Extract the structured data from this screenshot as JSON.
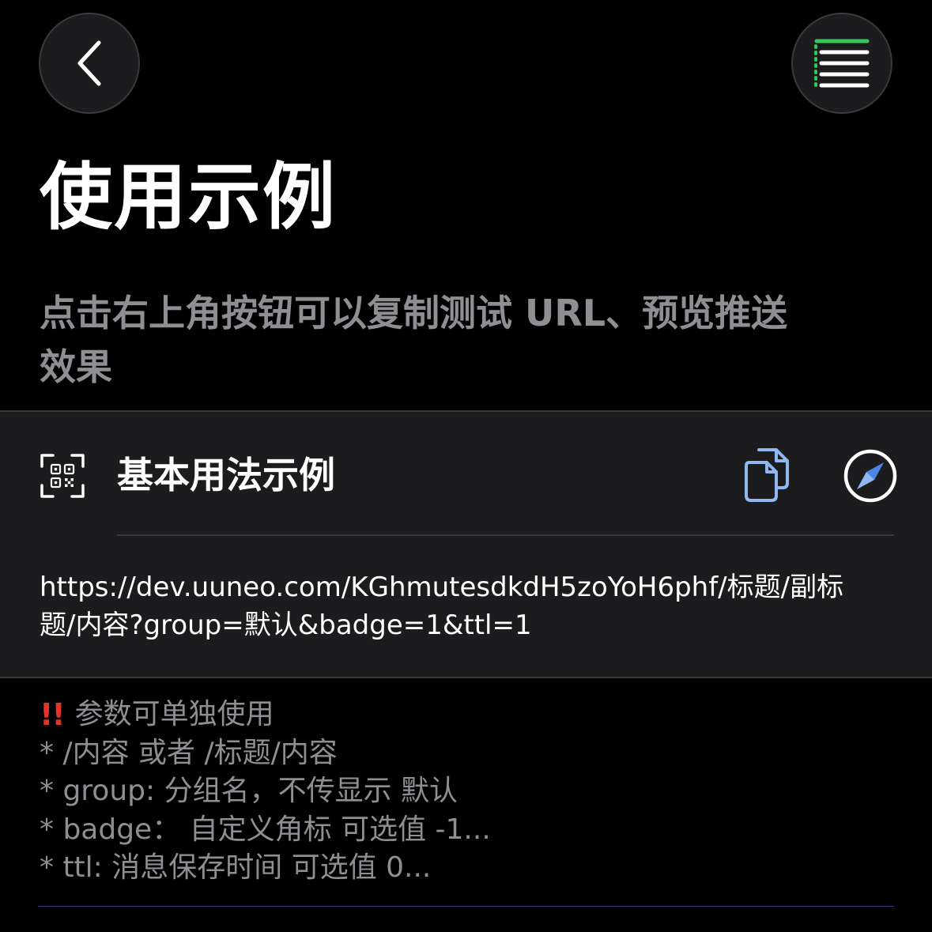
{
  "header": {
    "back_icon": "chevron-left-icon",
    "menu_icon": "list-icon",
    "accent_color": "#34c759"
  },
  "page": {
    "title": "使用示例",
    "subtitle": "点击右上角按钮可以复制测试 URL、预览推送效果"
  },
  "card": {
    "icon": "qrcode-scan-icon",
    "title": "基本用法示例",
    "copy_icon": "doc-copy-icon",
    "copy_color": "#8fb8f0",
    "safari_icon": "compass-icon",
    "url": "https://dev.uuneo.com/KGhmutesdkdH5zoYoH6phf/标题/副标题/内容?group=默认&badge=1&ttl=1"
  },
  "notes": {
    "warning_glyph": "!!",
    "warning_color": "#e5322d",
    "heading": "参数可单独使用",
    "lines": [
      "* /内容 或者 /标题/内容",
      "* group: 分组名，不传显示 默认",
      "* badge： 自定义角标 可选值 -1...",
      "* ttl: 消息保存时间 可选值 0..."
    ]
  }
}
